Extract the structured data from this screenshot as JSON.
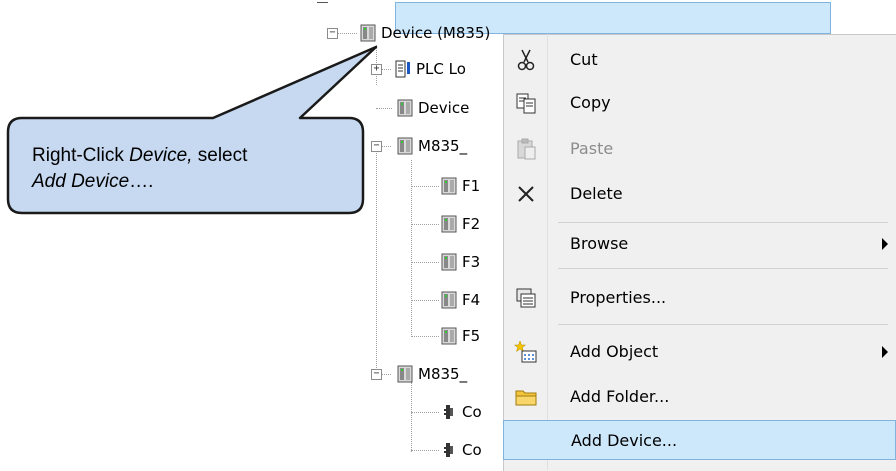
{
  "tree": {
    "root_label": "Device (M835)",
    "items": [
      {
        "label": "PLC Lo"
      },
      {
        "label": "Device"
      },
      {
        "label": "M835_"
      },
      {
        "label": "F1"
      },
      {
        "label": "F2"
      },
      {
        "label": "F3"
      },
      {
        "label": "F4"
      },
      {
        "label": "F5"
      },
      {
        "label": "M835_"
      },
      {
        "label": "Co"
      },
      {
        "label": "Co"
      }
    ]
  },
  "context_menu": {
    "items": [
      {
        "label": "Cut",
        "icon": "scissors-icon",
        "enabled": true
      },
      {
        "label": "Copy",
        "icon": "copy-icon",
        "enabled": true
      },
      {
        "label": "Paste",
        "icon": "paste-icon",
        "enabled": false
      },
      {
        "label": "Delete",
        "icon": "delete-x-icon",
        "enabled": true
      },
      {
        "label": "Browse",
        "submenu": true,
        "enabled": true
      },
      {
        "label": "Properties...",
        "icon": "properties-icon",
        "enabled": true
      },
      {
        "label": "Add Object",
        "icon": "add-object-icon",
        "submenu": true,
        "enabled": true
      },
      {
        "label": "Add Folder...",
        "icon": "folder-icon",
        "enabled": true
      },
      {
        "label": "Add Device...",
        "enabled": true,
        "highlighted": true
      }
    ]
  },
  "callout": {
    "line1_a": "Right-Click ",
    "line1_em": "Device,",
    "line1_b": " select",
    "line2_em": "Add Device",
    "line2_b": "…."
  },
  "colors": {
    "selection": "#cde8fb",
    "selection_border": "#7fb3e0",
    "callout_fill": "#c6d9f1",
    "menu_bg": "#f0f0f0"
  }
}
